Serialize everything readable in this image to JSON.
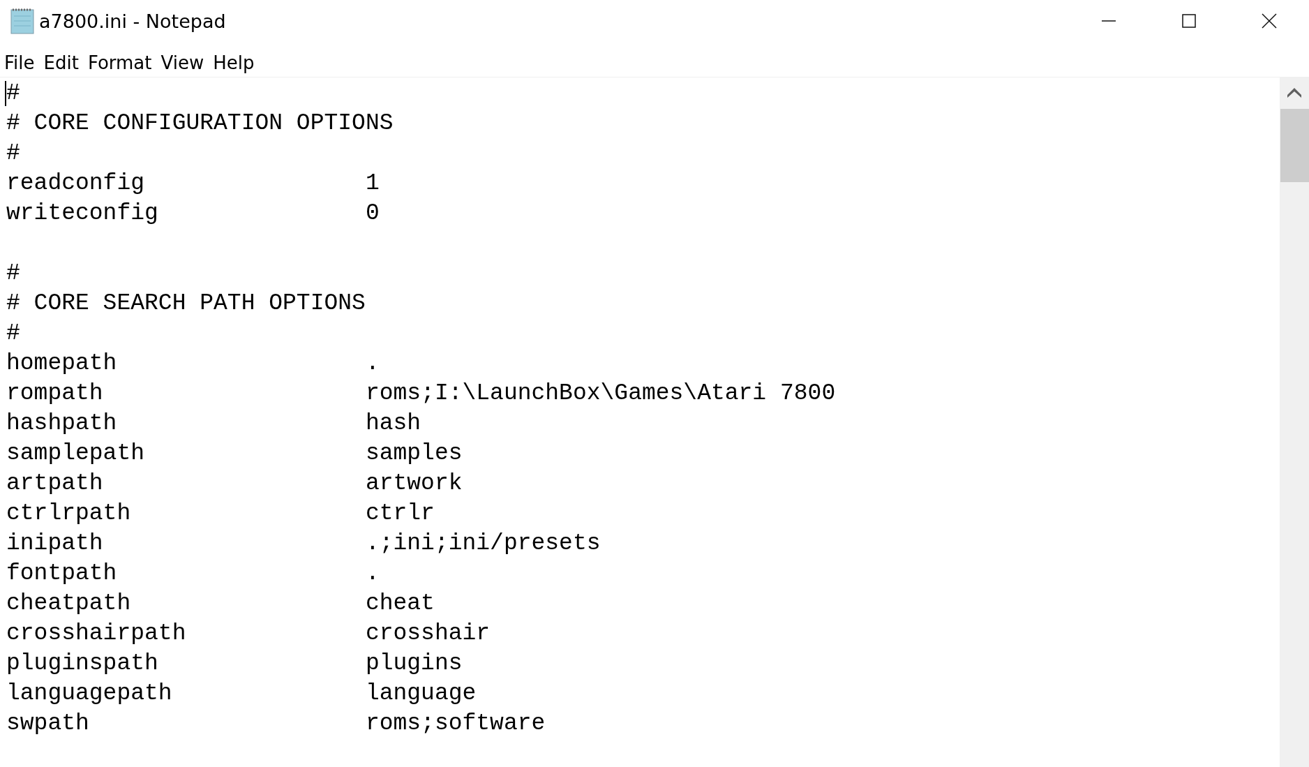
{
  "window": {
    "title": "a7800.ini - Notepad"
  },
  "menu": [
    "File",
    "Edit",
    "Format",
    "View",
    "Help"
  ],
  "lines": [
    {
      "kind": "comment",
      "text": "#"
    },
    {
      "kind": "comment",
      "text": "# CORE CONFIGURATION OPTIONS"
    },
    {
      "kind": "comment",
      "text": "#"
    },
    {
      "kind": "setting",
      "key": "readconfig",
      "value": "1"
    },
    {
      "kind": "setting",
      "key": "writeconfig",
      "value": "0"
    },
    {
      "kind": "blank"
    },
    {
      "kind": "comment",
      "text": "#"
    },
    {
      "kind": "comment",
      "text": "# CORE SEARCH PATH OPTIONS"
    },
    {
      "kind": "comment",
      "text": "#"
    },
    {
      "kind": "setting",
      "key": "homepath",
      "value": "."
    },
    {
      "kind": "setting",
      "key": "rompath",
      "value": "roms;I:\\LaunchBox\\Games\\Atari 7800"
    },
    {
      "kind": "setting",
      "key": "hashpath",
      "value": "hash"
    },
    {
      "kind": "setting",
      "key": "samplepath",
      "value": "samples"
    },
    {
      "kind": "setting",
      "key": "artpath",
      "value": "artwork"
    },
    {
      "kind": "setting",
      "key": "ctrlrpath",
      "value": "ctrlr"
    },
    {
      "kind": "setting",
      "key": "inipath",
      "value": ".;ini;ini/presets"
    },
    {
      "kind": "setting",
      "key": "fontpath",
      "value": "."
    },
    {
      "kind": "setting",
      "key": "cheatpath",
      "value": "cheat"
    },
    {
      "kind": "setting",
      "key": "crosshairpath",
      "value": "crosshair"
    },
    {
      "kind": "setting",
      "key": "pluginspath",
      "value": "plugins"
    },
    {
      "kind": "setting",
      "key": "languagepath",
      "value": "language"
    },
    {
      "kind": "setting",
      "key": "swpath",
      "value": "roms;software"
    }
  ]
}
